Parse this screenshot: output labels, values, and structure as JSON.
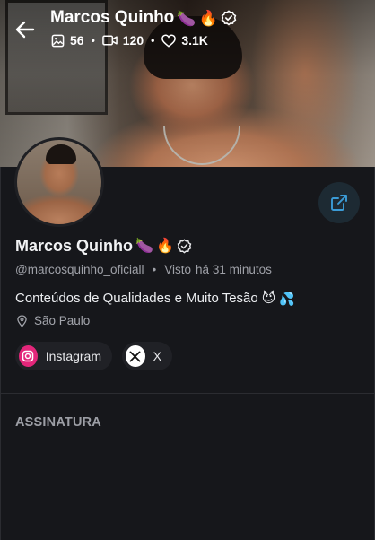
{
  "profile": {
    "name": "Marcos Quinho",
    "name_emojis": [
      "🍆",
      "🔥"
    ],
    "handle": "@marcosquinho_oficiall",
    "seen_label": "Visto",
    "seen_time": "há 31 minutos",
    "bio": "Conteúdos de Qualidades e Muito Tesão",
    "bio_emojis": [
      "😈",
      "💦"
    ],
    "location": "São Paulo"
  },
  "stats": {
    "photos": "56",
    "videos": "120",
    "likes": "3.1K"
  },
  "social_links": [
    {
      "label": "Instagram",
      "icon": "instagram-icon"
    },
    {
      "label": "X",
      "icon": "x-logo-icon"
    }
  ],
  "section": {
    "title": "ASSINATURA"
  },
  "icons": {
    "back": "arrow-left-icon",
    "verified": "verified-badge-icon",
    "photos": "image-icon",
    "videos": "video-icon",
    "likes": "heart-icon",
    "share": "share-icon",
    "location": "map-pin-icon"
  },
  "colors": {
    "background": "#16171b",
    "instagram": "#e3267a",
    "share_accent": "#3b9bd6",
    "muted_text": "#9fa1a8"
  }
}
